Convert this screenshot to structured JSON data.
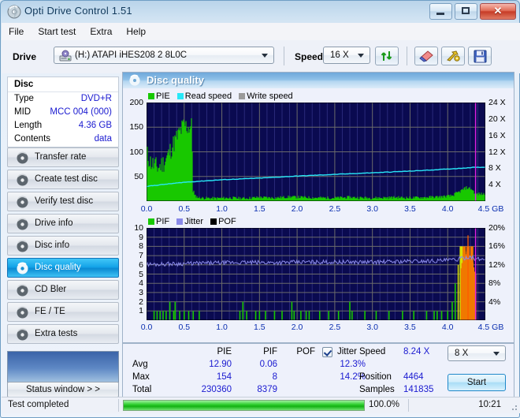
{
  "window": {
    "title": "Opti Drive Control 1.51",
    "icon": "disc-icon",
    "buttons": {
      "minimize": "minimize",
      "maximize": "maximize",
      "close": "close"
    }
  },
  "menu": {
    "items": [
      "File",
      "Start test",
      "Extra",
      "Help"
    ]
  },
  "toolbar": {
    "drive_label": "Drive",
    "drive_value": "(H:)  ATAPI iHES208   2 8L0C",
    "speed_label": "Speed",
    "speed_value": "16 X",
    "buttons": [
      {
        "name": "refresh-button",
        "icon": "refresh-arrows-icon"
      },
      {
        "name": "eject-button",
        "icon": "eraser-icon"
      },
      {
        "name": "settings-button",
        "icon": "tools-icon"
      },
      {
        "name": "save-button",
        "icon": "floppy-save-icon"
      }
    ]
  },
  "disc": {
    "header": "Disc",
    "rows": [
      {
        "key": "Type",
        "value": "DVD+R"
      },
      {
        "key": "MID",
        "value": "MCC 004 (000)"
      },
      {
        "key": "Length",
        "value": "4.36 GB"
      },
      {
        "key": "Contents",
        "value": "data"
      }
    ]
  },
  "nav": {
    "items": [
      {
        "label": "Transfer rate",
        "icon": "disc-icon",
        "selected": false
      },
      {
        "label": "Create test disc",
        "icon": "disc-icon",
        "selected": false
      },
      {
        "label": "Verify test disc",
        "icon": "disc-icon",
        "selected": false
      },
      {
        "label": "Drive info",
        "icon": "disc-icon",
        "selected": false
      },
      {
        "label": "Disc info",
        "icon": "disc-icon",
        "selected": false
      },
      {
        "label": "Disc quality",
        "icon": "disc-icon",
        "selected": true
      },
      {
        "label": "CD Bler",
        "icon": "disc-icon",
        "selected": false
      },
      {
        "label": "FE / TE",
        "icon": "disc-icon",
        "selected": false
      },
      {
        "label": "Extra tests",
        "icon": "disc-icon",
        "selected": false
      }
    ],
    "status_window_button": "Status window > >"
  },
  "quality_panel": {
    "title": "Disc quality",
    "icon": "disc-quality-icon"
  },
  "stats": {
    "columns": [
      "PIE",
      "PIF",
      "POF",
      "Jitter"
    ],
    "jitter_checked": true,
    "rows": [
      {
        "label": "Avg",
        "pie": "12.90",
        "pif": "0.06",
        "pof": "",
        "jitter": "12.3%"
      },
      {
        "label": "Max",
        "pie": "154",
        "pif": "8",
        "pof": "",
        "jitter": "14.2%"
      },
      {
        "label": "Total",
        "pie": "230360",
        "pif": "8379",
        "pof": "",
        "jitter": ""
      }
    ],
    "speed_label": "Speed",
    "speed_value": "8.24 X",
    "position_label": "Position",
    "position_value": "4464",
    "samples_label": "Samples",
    "samples_value": "141835",
    "speed_select": "8 X",
    "start_button": "Start"
  },
  "statusbar": {
    "message": "Test completed",
    "progress_text": "100.0%",
    "progress_percent": 100,
    "time": "10:21"
  },
  "colors": {
    "pie_green": "#18c800",
    "read_speed_cyan": "#28e8f8",
    "write_speed_gray": "#9a9a9a",
    "pif_green": "#18c800",
    "jitter_blue": "#8a8ae8",
    "pof_black": "#000000",
    "plot_bg": "#0a0a50",
    "marker_magenta": "#e020e0",
    "orange_spike": "#f07800"
  },
  "chart_data": [
    {
      "type": "area",
      "name": "disc-quality-pie-chart",
      "title": "Disc quality",
      "xlabel": "GB",
      "ylabel": "PIE",
      "xlim": [
        0.0,
        4.5
      ],
      "ylim": [
        0,
        200
      ],
      "xticks": [
        "0.0",
        "0.5",
        "1.0",
        "1.5",
        "2.0",
        "2.5",
        "3.0",
        "3.5",
        "4.0",
        "4.5 GB"
      ],
      "yticks": [
        "50",
        "100",
        "150",
        "200"
      ],
      "y2ticks": [
        "4 X",
        "8 X",
        "12 X",
        "16 X",
        "20 X",
        "24 X"
      ],
      "y2lim": [
        0,
        24
      ],
      "grid": true,
      "legend": [
        {
          "label": "PIE",
          "color": "#18c800"
        },
        {
          "label": "Read speed",
          "color": "#28e8f8"
        },
        {
          "label": "Write speed",
          "color": "#9a9a9a"
        }
      ],
      "marker_x": 4.37,
      "series": [
        {
          "name": "PIE",
          "color": "#18c800",
          "x": [
            0.0,
            0.05,
            0.1,
            0.15,
            0.2,
            0.25,
            0.3,
            0.35,
            0.4,
            0.45,
            0.5,
            0.55,
            0.6,
            0.62,
            0.7,
            0.9,
            1.1,
            1.3,
            1.5,
            1.7,
            1.9,
            2.1,
            2.3,
            2.5,
            2.7,
            2.9,
            3.1,
            3.3,
            3.5,
            3.7,
            3.9,
            4.05,
            4.15,
            4.25,
            4.32,
            4.37
          ],
          "values": [
            95,
            78,
            70,
            66,
            72,
            80,
            95,
            112,
            126,
            140,
            152,
            148,
            150,
            12,
            6,
            5,
            6,
            5,
            7,
            6,
            8,
            7,
            6,
            6,
            7,
            6,
            6,
            7,
            6,
            7,
            8,
            10,
            18,
            27,
            24,
            14
          ]
        },
        {
          "name": "Read speed",
          "color": "#28e8f8",
          "x": [
            0.0,
            0.5,
            1.0,
            1.5,
            2.0,
            2.5,
            3.0,
            3.5,
            4.0,
            4.37
          ],
          "values": [
            3.6,
            4.6,
            5.2,
            5.6,
            6.1,
            6.5,
            6.9,
            7.3,
            7.8,
            8.24
          ]
        },
        {
          "name": "Write speed",
          "color": "#9a9a9a",
          "x": [],
          "values": []
        }
      ]
    },
    {
      "type": "area",
      "name": "disc-quality-pif-chart",
      "xlabel": "GB",
      "ylabel": "PIF",
      "xlim": [
        0.0,
        4.5
      ],
      "ylim": [
        0,
        10
      ],
      "xticks": [
        "0.0",
        "0.5",
        "1.0",
        "1.5",
        "2.0",
        "2.5",
        "3.0",
        "3.5",
        "4.0",
        "4.5 GB"
      ],
      "yticks": [
        "1",
        "2",
        "3",
        "4",
        "5",
        "6",
        "7",
        "8",
        "9",
        "10"
      ],
      "y2ticks": [
        "4%",
        "8%",
        "12%",
        "16%",
        "20%"
      ],
      "y2lim": [
        0,
        20
      ],
      "grid": true,
      "legend": [
        {
          "label": "PIF",
          "color": "#18c800"
        },
        {
          "label": "Jitter",
          "color": "#8a8ae8"
        },
        {
          "label": "POF",
          "color": "#000000"
        }
      ],
      "marker_x": 4.37,
      "series": [
        {
          "name": "PIF",
          "color": "#18c800",
          "x": [
            0.1,
            0.14,
            0.18,
            0.22,
            0.26,
            0.31,
            0.36,
            0.38,
            0.44,
            0.5,
            0.56,
            0.62,
            0.7,
            1.24,
            1.28,
            1.33,
            1.45,
            1.5,
            1.58,
            1.7,
            1.8,
            1.93,
            1.96,
            2.05,
            2.12,
            2.16,
            2.3,
            2.42,
            2.55,
            2.7,
            2.73,
            2.9,
            3.05,
            3.22,
            3.4,
            3.55,
            3.72,
            3.82,
            3.86,
            3.92,
            4.0,
            4.06,
            4.1,
            4.14,
            4.18,
            4.22,
            4.27,
            4.32,
            4.36
          ],
          "values": [
            1,
            1,
            1,
            1,
            1,
            2,
            1,
            2,
            1,
            1,
            1,
            1,
            1,
            1,
            2,
            1,
            1,
            1,
            1,
            1,
            1,
            2,
            1,
            1,
            1,
            1,
            1,
            1,
            1,
            2,
            1,
            1,
            1,
            1,
            1,
            1,
            1,
            1,
            1,
            1,
            1,
            2,
            4,
            6,
            8,
            8,
            8,
            8,
            5
          ]
        },
        {
          "name": "Jitter",
          "color": "#8a8ae8",
          "x": [
            0.0,
            0.3,
            0.6,
            0.9,
            1.2,
            1.5,
            1.8,
            2.1,
            2.4,
            2.7,
            3.0,
            3.3,
            3.6,
            3.9,
            4.1,
            4.2,
            4.3,
            4.37
          ],
          "values": [
            12.1,
            12.2,
            12.3,
            12.4,
            12.5,
            12.5,
            12.5,
            12.6,
            12.6,
            12.6,
            12.6,
            12.7,
            12.8,
            12.9,
            13.1,
            13.4,
            13.8,
            13.2
          ]
        },
        {
          "name": "POF",
          "color": "#000000",
          "x": [],
          "values": []
        }
      ]
    }
  ]
}
